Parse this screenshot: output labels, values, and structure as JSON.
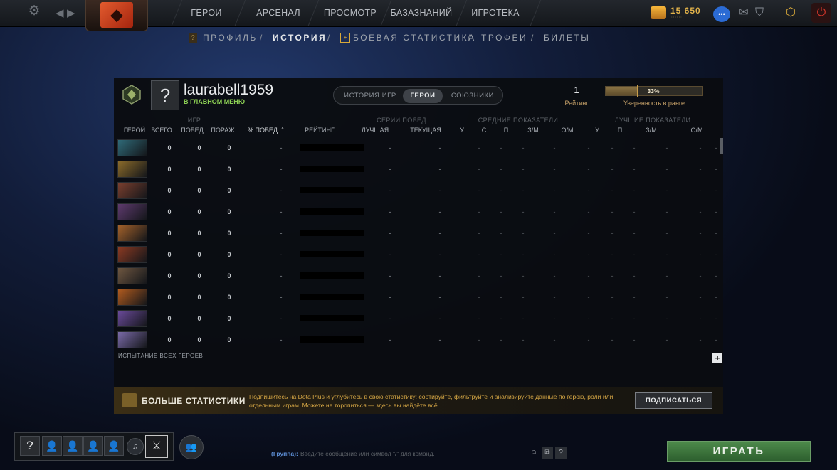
{
  "topnav": {
    "items": [
      "ГЕРОИ",
      "АРСЕНАЛ",
      "ПРОСМОТР",
      "БАЗАЗНАНИЙ",
      "ИГРОТЕКА"
    ],
    "shards": "15 650",
    "shards_dots": "○○○"
  },
  "subnav": {
    "items": [
      "ПРОФИЛЬ",
      "ИСТОРИЯ",
      "БОЕВАЯ СТАТИСТИКА",
      "ТРОФЕИ",
      "БИЛЕТЫ"
    ],
    "separator": "/",
    "active": "ИСТОРИЯ"
  },
  "profile": {
    "avatar_symbol": "?",
    "name": "laurabell1959",
    "status": "В ГЛАВНОМ МЕНЮ",
    "rating_value": "1",
    "rating_label": "Рейтинг",
    "confidence_value": "33%",
    "confidence_fraction": 0.33,
    "confidence_label": "Уверенность в ранге"
  },
  "tabs": [
    "ИСТОРИЯ ИГР",
    "ГЕРОИ",
    "СОЮЗНИКИ"
  ],
  "active_tab": "ГЕРОИ",
  "group_headers": {
    "games": "ИГР",
    "streaks": "СЕРИИ ПОБЕД",
    "average": "СРЕДНИЕ ПОКАЗАТЕЛИ",
    "best": "ЛУЧШИЕ ПОКАЗАТЕЛИ"
  },
  "columns": {
    "hero": "ГЕРОЙ",
    "total": "ВСЕГО",
    "wins": "ПОБЕД",
    "losses": "ПОРАЖ",
    "winrate": "% ПОБЕД",
    "sort_indicator": "^",
    "rating": "РЕЙТИНГ",
    "best_streak": "ЛУЧШАЯ",
    "current_streak": "ТЕКУЩАЯ",
    "avg_k": "У",
    "avg_d": "С",
    "avg_a": "П",
    "avg_gpm": "З/М",
    "avg_xpm": "О/М",
    "best_k": "У",
    "best_a": "П",
    "best_gpm": "З/М",
    "best_xpm": "О/М"
  },
  "rows": [
    {
      "hero_icon": "hero-portrait-1",
      "total": "0",
      "wins": "0",
      "losses": "0",
      "winrate": "-",
      "best": "-",
      "current": "-",
      "avg": [
        "-",
        "-",
        "-",
        "-",
        "-"
      ],
      "bests": [
        "-",
        "-",
        "-",
        "-",
        "-",
        "-"
      ]
    },
    {
      "hero_icon": "hero-portrait-2",
      "total": "0",
      "wins": "0",
      "losses": "0",
      "winrate": "-",
      "best": "-",
      "current": "-",
      "avg": [
        "-",
        "-",
        "-",
        "-",
        "-"
      ],
      "bests": [
        "-",
        "-",
        "-",
        "-",
        "-",
        "-"
      ]
    },
    {
      "hero_icon": "hero-portrait-3",
      "total": "0",
      "wins": "0",
      "losses": "0",
      "winrate": "-",
      "best": "-",
      "current": "-",
      "avg": [
        "-",
        "-",
        "-",
        "-",
        "-"
      ],
      "bests": [
        "-",
        "-",
        "-",
        "-",
        "-",
        "-"
      ]
    },
    {
      "hero_icon": "hero-portrait-4",
      "total": "0",
      "wins": "0",
      "losses": "0",
      "winrate": "-",
      "best": "-",
      "current": "-",
      "avg": [
        "-",
        "-",
        "-",
        "-",
        "-"
      ],
      "bests": [
        "-",
        "-",
        "-",
        "-",
        "-",
        "-"
      ]
    },
    {
      "hero_icon": "hero-portrait-5",
      "total": "0",
      "wins": "0",
      "losses": "0",
      "winrate": "-",
      "best": "-",
      "current": "-",
      "avg": [
        "-",
        "-",
        "-",
        "-",
        "-"
      ],
      "bests": [
        "-",
        "-",
        "-",
        "-",
        "-",
        "-"
      ]
    },
    {
      "hero_icon": "hero-portrait-6",
      "total": "0",
      "wins": "0",
      "losses": "0",
      "winrate": "-",
      "best": "-",
      "current": "-",
      "avg": [
        "-",
        "-",
        "-",
        "-",
        "-"
      ],
      "bests": [
        "-",
        "-",
        "-",
        "-",
        "-",
        "-"
      ]
    },
    {
      "hero_icon": "hero-portrait-7",
      "total": "0",
      "wins": "0",
      "losses": "0",
      "winrate": "-",
      "best": "-",
      "current": "-",
      "avg": [
        "-",
        "-",
        "-",
        "-",
        "-"
      ],
      "bests": [
        "-",
        "-",
        "-",
        "-",
        "-",
        "-"
      ]
    },
    {
      "hero_icon": "hero-portrait-8",
      "total": "0",
      "wins": "0",
      "losses": "0",
      "winrate": "-",
      "best": "-",
      "current": "-",
      "avg": [
        "-",
        "-",
        "-",
        "-",
        "-"
      ],
      "bests": [
        "-",
        "-",
        "-",
        "-",
        "-",
        "-"
      ]
    },
    {
      "hero_icon": "hero-portrait-9",
      "total": "0",
      "wins": "0",
      "losses": "0",
      "winrate": "-",
      "best": "-",
      "current": "-",
      "avg": [
        "-",
        "-",
        "-",
        "-",
        "-"
      ],
      "bests": [
        "-",
        "-",
        "-",
        "-",
        "-",
        "-"
      ]
    },
    {
      "hero_icon": "hero-portrait-10",
      "total": "0",
      "wins": "0",
      "losses": "0",
      "winrate": "-",
      "best": "-",
      "current": "-",
      "avg": [
        "-",
        "-",
        "-",
        "-",
        "-"
      ],
      "bests": [
        "-",
        "-",
        "-",
        "-",
        "-",
        "-"
      ]
    }
  ],
  "hero_colors": [
    "#2f6a78",
    "#8a6a2a",
    "#7a3f2e",
    "#5e3a6e",
    "#a3612a",
    "#8c3a22",
    "#6e5640",
    "#b05a1e",
    "#6a4a9a",
    "#7a6aa8"
  ],
  "trial_label": "ИСПЫТАНИЕ ВСЕХ ГЕРОЕВ",
  "plus_label": "+",
  "promo": {
    "title": "БОЛЬШЕ СТАТИСТИКИ",
    "text": "Подпишитесь на Dota Plus и углубитесь в свою статистику: сортируйте, фильтруйте и анализируйте данные по герою, роли или отдельным играм. Можете не торопиться — здесь вы найдёте всё.",
    "button": "ПОДПИСАТЬСЯ"
  },
  "party": {
    "self_symbol": "?"
  },
  "chat": {
    "channel": "(Группа):",
    "placeholder": "Введите сообщение или символ \"/\" для команд.",
    "help": "?"
  },
  "play_button": "ИГРАТЬ",
  "colors": {
    "accent_gold": "#c9a36a",
    "status_green": "#8ccf54",
    "play_green": "#3f7a3e",
    "promo_text": "#d6a745"
  }
}
